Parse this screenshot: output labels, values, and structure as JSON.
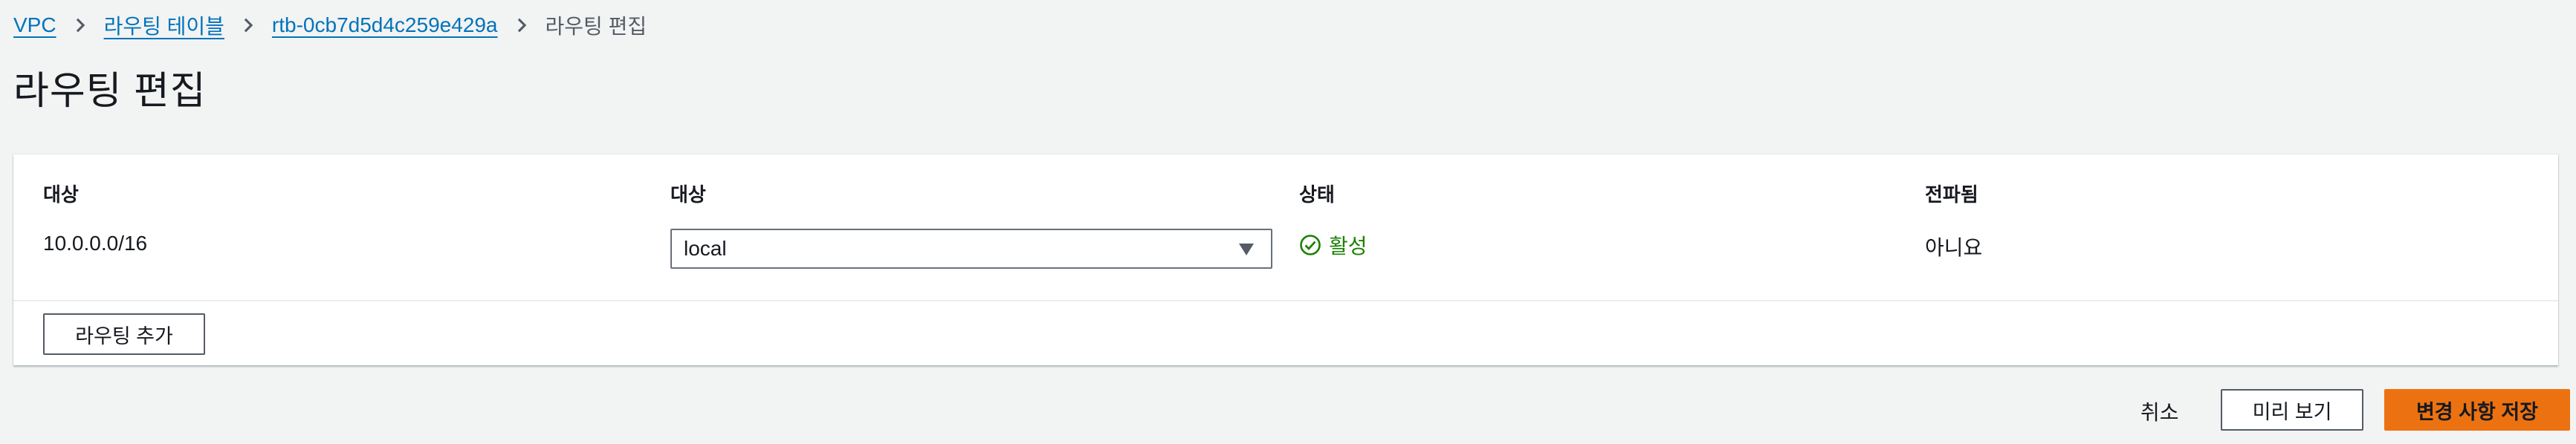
{
  "breadcrumb": {
    "items": [
      "VPC",
      "라우팅 테이블",
      "rtb-0cb7d5d4c259e429a"
    ],
    "current": "라우팅 편집"
  },
  "page": {
    "title": "라우팅 편집"
  },
  "routes_table": {
    "headers": [
      "대상",
      "대상",
      "상태",
      "전파됨"
    ],
    "rows": [
      {
        "destination": "10.0.0.0/16",
        "target": "local",
        "status": "활성",
        "propagated": "아니요"
      }
    ],
    "add_button": "라우팅 추가"
  },
  "actions": {
    "cancel": "취소",
    "preview": "미리 보기",
    "save": "변경 사항 저장"
  },
  "colors": {
    "link": "#0073bb",
    "status_active": "#1d8102",
    "primary_button": "#ec7211"
  },
  "icons": [
    "chevron-right-icon",
    "caret-down-icon",
    "status-success-icon"
  ]
}
